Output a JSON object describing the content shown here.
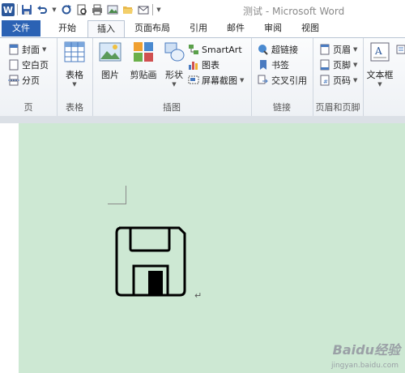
{
  "window": {
    "title": "测试 - Microsoft Word"
  },
  "tabs": [
    "文件",
    "开始",
    "插入",
    "页面布局",
    "引用",
    "邮件",
    "审阅",
    "视图"
  ],
  "ribbon": {
    "pages": {
      "cover": "封面",
      "blank": "空白页",
      "break": "分页",
      "label": "页"
    },
    "tables": {
      "table": "表格",
      "label": "表格"
    },
    "illustrations": {
      "picture": "图片",
      "clipart": "剪贴画",
      "shapes": "形状",
      "smartart": "SmartArt",
      "chart": "图表",
      "screenshot": "屏幕截图",
      "label": "插图"
    },
    "links": {
      "hyperlink": "超链接",
      "bookmark": "书签",
      "crossref": "交叉引用",
      "label": "链接"
    },
    "headerfooter": {
      "header": "页眉",
      "footer": "页脚",
      "pagenum": "页码",
      "label": "页眉和页脚"
    },
    "text": {
      "textbox": "文本框"
    }
  },
  "document": {
    "paragraph_mark": "↵"
  },
  "watermark": {
    "brand": "Baidu经验",
    "url": "jingyan.baidu.com"
  }
}
